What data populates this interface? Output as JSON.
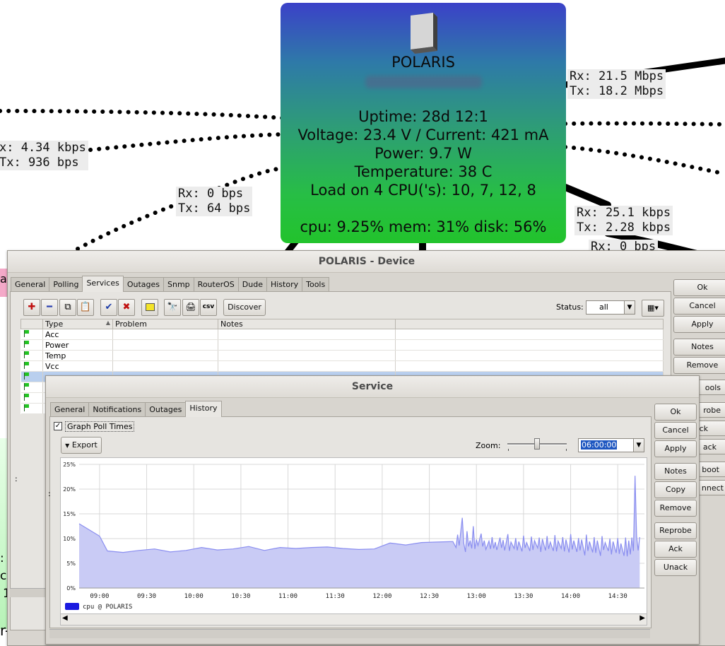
{
  "map": {
    "labels": [
      {
        "text": "x: 4.34 kbps\nTx: 936 bps"
      },
      {
        "text": "Rx: 0 bps\nTx: 64 bps"
      },
      {
        "text": "Rx: 21.5 Mbps\nTx: 18.2 Mbps"
      },
      {
        "text": "Rx: 25.1 kbps\nTx: 2.28 kbps"
      },
      {
        "text": "Rx: 0 bps"
      }
    ],
    "left_fragments": [
      "al",
      ":",
      "c",
      "1",
      "r-Tem"
    ]
  },
  "device_node": {
    "name": "POLARIS",
    "lines": [
      "Uptime: 28d 12:1",
      "Voltage: 23.4 V / Current: 421 mA",
      "Power: 9.7 W",
      "Temperature: 38 C",
      "Load on 4 CPU('s): 10, 7, 12, 8"
    ],
    "summary": "cpu: 9.25% mem: 31% disk: 56%"
  },
  "device_window": {
    "title": "POLARIS - Device",
    "tabs": [
      "General",
      "Polling",
      "Services",
      "Outages",
      "Snmp",
      "RouterOS",
      "Dude",
      "History",
      "Tools"
    ],
    "active_tab": "Services",
    "toolbar": {
      "discover_label": "Discover",
      "csv_label": "csv",
      "status_label": "Status:",
      "status_value": "all"
    },
    "columns": [
      "Type",
      "Problem",
      "Notes"
    ],
    "rows": [
      {
        "type": "Acc",
        "problem": "",
        "notes": ""
      },
      {
        "type": "Power",
        "problem": "",
        "notes": ""
      },
      {
        "type": "Temp",
        "problem": "",
        "notes": ""
      },
      {
        "type": "Vcc",
        "problem": "",
        "notes": ""
      }
    ],
    "buttons": [
      "Ok",
      "Cancel",
      "Apply",
      "Notes",
      "Remove"
    ],
    "hidden_buttons": [
      "ools",
      "robe",
      "ck",
      "ack",
      "boot",
      "nnect"
    ],
    "left_marker": ":"
  },
  "service_window": {
    "title": "Service",
    "tabs": [
      "General",
      "Notifications",
      "Outages",
      "History"
    ],
    "active_tab": "History",
    "graph_poll_times_label": "Graph Poll Times",
    "graph_poll_times_checked": true,
    "export_label": "Export",
    "zoom_label": "Zoom:",
    "zoom_value": "06:00:00",
    "buttons": [
      "Ok",
      "Cancel",
      "Apply",
      "Notes",
      "Copy",
      "Remove",
      "Reprobe",
      "Ack",
      "Unack"
    ],
    "left_marker": ":"
  },
  "chart_data": {
    "type": "area",
    "ylim": [
      0,
      25
    ],
    "ytick_labels": [
      "25%",
      "20%",
      "15%",
      "10%",
      "5%",
      "0%"
    ],
    "xtick_labels": [
      "09:00",
      "09:30",
      "10:00",
      "10:30",
      "11:00",
      "11:30",
      "12:00",
      "12:30",
      "13:00",
      "13:30",
      "14:00",
      "14:30"
    ],
    "grid": true,
    "legend": "bottom-left",
    "color": "#8a8ef0",
    "fill_color": "#c9cbf5",
    "series": [
      {
        "name": "cpu @ POLARIS",
        "points": [
          [
            "08:47",
            13.0
          ],
          [
            "09:00",
            10.5
          ],
          [
            "09:05",
            7.5
          ],
          [
            "09:15",
            7.2
          ],
          [
            "09:25",
            7.6
          ],
          [
            "09:35",
            7.9
          ],
          [
            "09:45",
            7.3
          ],
          [
            "09:55",
            7.6
          ],
          [
            "10:05",
            8.2
          ],
          [
            "10:15",
            7.7
          ],
          [
            "10:25",
            7.9
          ],
          [
            "10:35",
            8.4
          ],
          [
            "10:45",
            7.6
          ],
          [
            "10:55",
            8.2
          ],
          [
            "11:05",
            8.0
          ],
          [
            "11:15",
            8.2
          ],
          [
            "11:25",
            8.3
          ],
          [
            "11:35",
            8.0
          ],
          [
            "11:45",
            7.8
          ],
          [
            "11:55",
            7.9
          ],
          [
            "12:05",
            9.1
          ],
          [
            "12:15",
            8.7
          ],
          [
            "12:25",
            9.2
          ],
          [
            "12:35",
            9.3
          ],
          [
            "12:45",
            9.4
          ],
          [
            "12:47",
            8.2
          ],
          [
            "12:48",
            10.8
          ],
          [
            "12:49",
            8.6
          ],
          [
            "12:51",
            14.2
          ],
          [
            "12:52",
            9.0
          ],
          [
            "12:53",
            7.3
          ],
          [
            "12:54",
            11.5
          ],
          [
            "12:55",
            8.4
          ],
          [
            "12:56",
            9.6
          ],
          [
            "12:57",
            8.0
          ],
          [
            "12:58",
            12.5
          ],
          [
            "12:59",
            7.9
          ],
          [
            "13:00",
            9.8
          ],
          [
            "13:01",
            8.6
          ],
          [
            "13:03",
            11.0
          ],
          [
            "13:04",
            8.4
          ],
          [
            "13:05",
            9.6
          ],
          [
            "13:06",
            7.8
          ],
          [
            "13:08",
            9.5
          ],
          [
            "13:09",
            7.9
          ],
          [
            "13:10",
            10.3
          ],
          [
            "13:11",
            8.0
          ],
          [
            "13:12",
            9.3
          ],
          [
            "13:13",
            7.7
          ],
          [
            "13:15",
            10.2
          ],
          [
            "13:16",
            8.1
          ],
          [
            "13:17",
            9.7
          ],
          [
            "13:18",
            7.6
          ],
          [
            "13:20",
            10.9
          ],
          [
            "13:21",
            7.5
          ],
          [
            "13:22",
            9.3
          ],
          [
            "13:24",
            8.0
          ],
          [
            "13:25",
            10.1
          ],
          [
            "13:26",
            7.6
          ],
          [
            "13:27",
            9.4
          ],
          [
            "13:29",
            7.4
          ],
          [
            "13:30",
            10.6
          ],
          [
            "13:31",
            8.1
          ],
          [
            "13:32",
            9.2
          ],
          [
            "13:34",
            7.5
          ],
          [
            "13:35",
            10.4
          ],
          [
            "13:36",
            7.7
          ],
          [
            "13:37",
            9.6
          ],
          [
            "13:39",
            8.1
          ],
          [
            "13:40",
            10.2
          ],
          [
            "13:41",
            7.3
          ],
          [
            "13:42",
            9.9
          ],
          [
            "13:44",
            7.6
          ],
          [
            "13:45",
            10.5
          ],
          [
            "13:46",
            7.9
          ],
          [
            "13:47",
            9.3
          ],
          [
            "13:49",
            7.5
          ],
          [
            "13:50",
            10.7
          ],
          [
            "13:51",
            7.4
          ],
          [
            "13:52",
            9.5
          ],
          [
            "13:54",
            8.0
          ],
          [
            "13:55",
            10.3
          ],
          [
            "13:56",
            7.4
          ],
          [
            "13:57",
            9.8
          ],
          [
            "13:59",
            7.2
          ],
          [
            "14:00",
            10.9
          ],
          [
            "14:01",
            7.8
          ],
          [
            "14:02",
            9.6
          ],
          [
            "14:04",
            7.3
          ],
          [
            "14:05",
            10.1
          ],
          [
            "14:06",
            7.6
          ],
          [
            "14:07",
            9.8
          ],
          [
            "14:09",
            6.6
          ],
          [
            "14:10",
            10.8
          ],
          [
            "14:11",
            7.5
          ],
          [
            "14:12",
            9.4
          ],
          [
            "14:14",
            7.2
          ],
          [
            "14:15",
            10.3
          ],
          [
            "14:16",
            7.1
          ],
          [
            "14:17",
            9.6
          ],
          [
            "14:19",
            6.5
          ],
          [
            "14:20",
            10.5
          ],
          [
            "14:21",
            7.7
          ],
          [
            "14:22",
            9.2
          ],
          [
            "14:24",
            7.5
          ],
          [
            "14:25",
            10.0
          ],
          [
            "14:26",
            6.8
          ],
          [
            "14:27",
            9.4
          ],
          [
            "14:29",
            7.1
          ],
          [
            "14:30",
            10.1
          ],
          [
            "14:31",
            6.9
          ],
          [
            "14:32",
            9.0
          ],
          [
            "14:34",
            6.5
          ],
          [
            "14:35",
            10.2
          ],
          [
            "14:36",
            6.4
          ],
          [
            "14:37",
            9.6
          ],
          [
            "14:38",
            6.8
          ],
          [
            "14:39",
            10.2
          ],
          [
            "14:40",
            7.5
          ],
          [
            "14:41",
            22.7
          ],
          [
            "14:42",
            10.5
          ],
          [
            "14:43",
            7.6
          ],
          [
            "14:44",
            10.3
          ]
        ]
      }
    ]
  }
}
